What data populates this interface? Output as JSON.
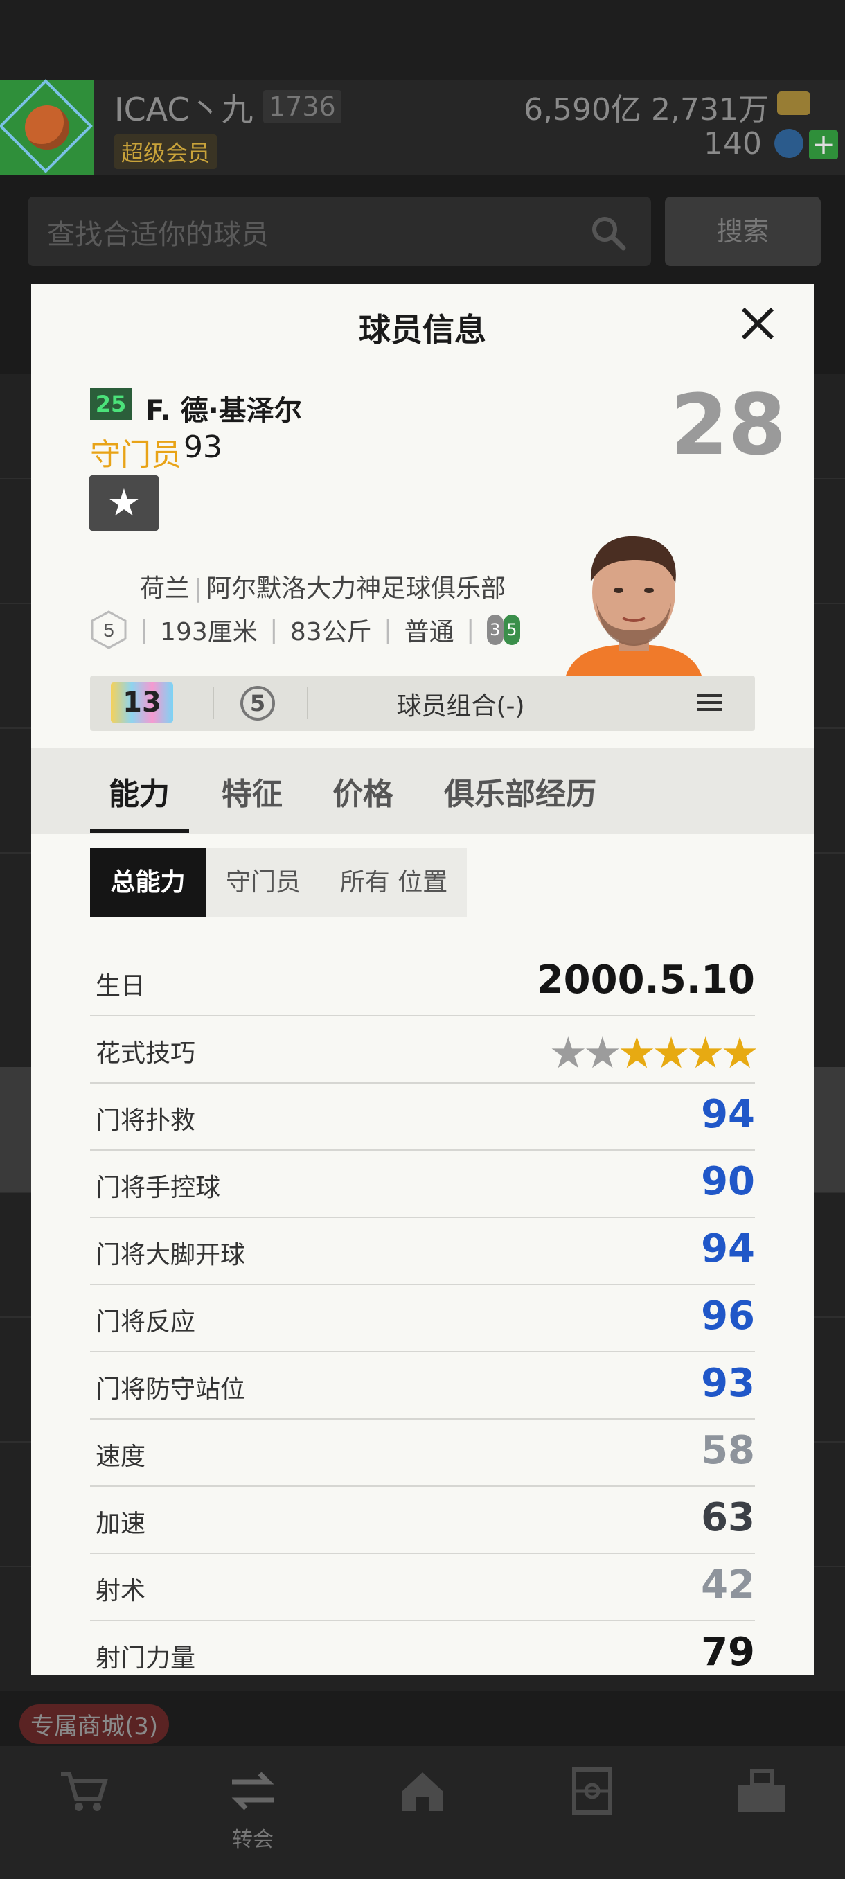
{
  "header": {
    "username": "ICAC丶九",
    "level": "1736",
    "member": "超级会员",
    "currency": "6,590亿 2,731万",
    "gems": "140"
  },
  "search": {
    "placeholder": "查找合适你的球员",
    "button_label": "搜索"
  },
  "footer": {
    "shop_badge": "专属商城(3)",
    "nav": [
      {
        "icon": "cart-icon",
        "label": ""
      },
      {
        "icon": "transfer-icon",
        "label": "转会"
      },
      {
        "icon": "home-icon",
        "label": ""
      },
      {
        "icon": "pitch-icon",
        "label": ""
      },
      {
        "icon": "locker-icon",
        "label": ""
      }
    ]
  },
  "modal": {
    "title": "球员信息",
    "player": {
      "badge_number": "25",
      "name": "F. 德·基泽尔",
      "position": "守门员",
      "position_rating": "93",
      "overall": "28",
      "nation": "荷兰",
      "club": "阿尔默洛大力神足球俱乐部",
      "grade": "5",
      "height": "193厘米",
      "weight": "83公斤",
      "body_type": "普通",
      "weak_foot_left": "3",
      "weak_foot_right": "5"
    },
    "combo_bar": {
      "card_level": "13",
      "circle_level": "5",
      "label": "球员组合(-)"
    },
    "tabs": [
      "能力",
      "特征",
      "价格",
      "俱乐部经历"
    ],
    "subtabs": [
      "总能力",
      "守门员",
      "所有 位置"
    ],
    "stats": [
      {
        "label": "生日",
        "value": "2000.5.10",
        "tone": "black"
      },
      {
        "label": "花式技巧",
        "stars_filled": 4,
        "stars_total": 6
      },
      {
        "label": "门将扑救",
        "value": "94",
        "tone": "blue"
      },
      {
        "label": "门将手控球",
        "value": "90",
        "tone": "blue"
      },
      {
        "label": "门将大脚开球",
        "value": "94",
        "tone": "blue"
      },
      {
        "label": "门将反应",
        "value": "96",
        "tone": "blue"
      },
      {
        "label": "门将防守站位",
        "value": "93",
        "tone": "blue"
      },
      {
        "label": "速度",
        "value": "58",
        "tone": "gray"
      },
      {
        "label": "加速",
        "value": "63",
        "tone": "dark"
      },
      {
        "label": "射术",
        "value": "42",
        "tone": "gray"
      },
      {
        "label": "射门力量",
        "value": "79",
        "tone": "black"
      }
    ]
  },
  "colors": {
    "accent_gold": "#e8a317",
    "stat_blue": "#2057c8",
    "badge_green": "#4be27a"
  }
}
